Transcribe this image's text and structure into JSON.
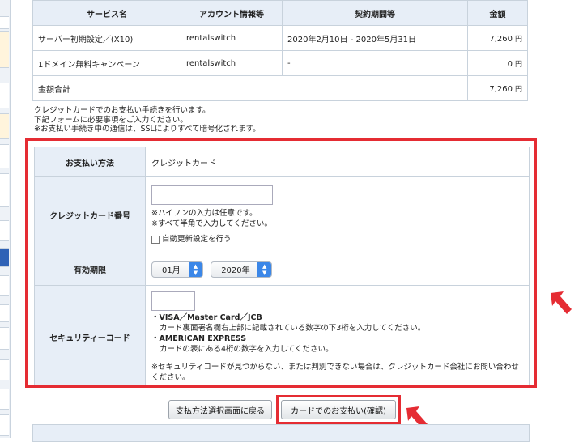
{
  "summary": {
    "headers": [
      "サービス名",
      "アカウント情報等",
      "契約期間等",
      "金額"
    ],
    "rows": [
      {
        "service": "サーバー初期設定／(X10)",
        "account": "rentalswitch",
        "period": "2020年2月10日 - 2020年5月31日",
        "amount": "7,260",
        "unit": "円"
      },
      {
        "service": "1ドメイン無料キャンペーン",
        "account": "rentalswitch",
        "period": "-",
        "amount": "0",
        "unit": "円"
      }
    ],
    "total_label": "金額合計",
    "total_amount": "7,260",
    "total_unit": "円"
  },
  "notes": [
    "クレジットカードでのお支払い手続きを行います。",
    "下記フォームに必要事項をご入力ください。",
    "※お支払い手続き中の通信は、SSLによりすべて暗号化されます。"
  ],
  "form": {
    "payment_method_label": "お支払い方法",
    "payment_method_value": "クレジットカード",
    "card_number_label": "クレジットカード番号",
    "card_number_value": "",
    "card_note_1": "※ハイフンの入力は任意です。",
    "card_note_2": "※すべて半角で入力してください。",
    "auto_renew_label": "自動更新設定を行う",
    "expiry_label": "有効期限",
    "expiry_month": "01月",
    "expiry_year": "2020年",
    "security_label": "セキュリティーコード",
    "security_value": "",
    "visa_title": "・VISA／Master Card／JCB",
    "visa_desc": "カード裏面署名欄右上部に記載されている数字の下3桁を入力してください。",
    "amex_title": "・AMERICAN EXPRESS",
    "amex_desc": "カードの表にある4桁の数字を入力してください。",
    "security_note": "※セキュリティコードが見つからない、または判別できない場合は、クレジットカード会社にお問い合わせください。"
  },
  "buttons": {
    "back": "支払方法選択画面に戻る",
    "confirm": "カードでのお支払い(確認)"
  },
  "colors": {
    "highlight": "#e52c33",
    "header_bg": "#e7eef7",
    "select_accent": "#3b87e8"
  },
  "icons": {
    "highlight_arrow": "red-arrow-icon",
    "select_arrows": "chevron-updown-icon"
  }
}
